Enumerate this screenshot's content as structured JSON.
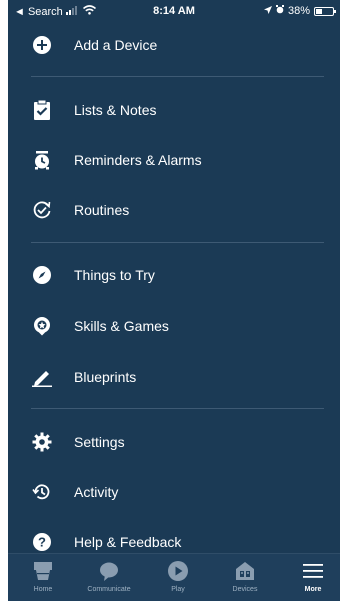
{
  "status": {
    "back_label": "◄ Search",
    "time": "8:14 AM",
    "battery": "38%",
    "battery_level": 0.38
  },
  "menu": [
    {
      "label": "Add a Device",
      "icon": "plus-circle-icon"
    },
    {
      "label": "Lists & Notes",
      "icon": "clipboard-check-icon"
    },
    {
      "label": "Reminders & Alarms",
      "icon": "alarm-clock-icon"
    },
    {
      "label": "Routines",
      "icon": "routine-check-icon"
    },
    {
      "label": "Things to Try",
      "icon": "compass-icon"
    },
    {
      "label": "Skills & Games",
      "icon": "skills-badge-icon"
    },
    {
      "label": "Blueprints",
      "icon": "pencil-icon"
    },
    {
      "label": "Settings",
      "icon": "gear-icon"
    },
    {
      "label": "Activity",
      "icon": "history-icon"
    },
    {
      "label": "Help & Feedback",
      "icon": "question-circle-icon"
    }
  ],
  "tabs": [
    {
      "label": "Home",
      "icon": "home-icon"
    },
    {
      "label": "Communicate",
      "icon": "chat-bubble-icon"
    },
    {
      "label": "Play",
      "icon": "play-icon"
    },
    {
      "label": "Devices",
      "icon": "devices-house-icon"
    },
    {
      "label": "More",
      "icon": "hamburger-icon",
      "active": true
    }
  ],
  "colors": {
    "background": "#1b3a55",
    "tabbar": "#1f3f5c",
    "divider": "#3e5a74",
    "inactive_tab": "#9fb2c3"
  }
}
